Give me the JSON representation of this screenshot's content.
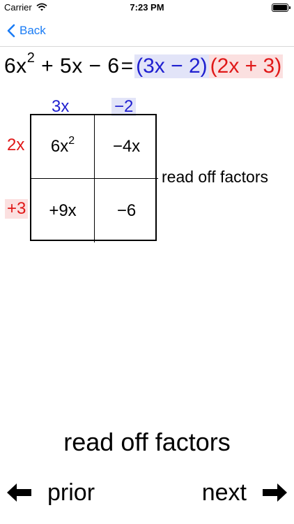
{
  "status_bar": {
    "carrier": "Carrier",
    "time": "7:23 PM"
  },
  "nav": {
    "back_label": "Back"
  },
  "equation": {
    "lhs_coef": "6x",
    "lhs_exp": "2",
    "lhs_rest": "+ 5x − 6",
    "equals": "=",
    "factor1": "(3x − 2)",
    "factor2": "(2x + 3)"
  },
  "grid": {
    "col_headers": [
      "3x",
      "−2"
    ],
    "row_headers": [
      "2x",
      "+3"
    ],
    "cells": [
      {
        "base": "6x",
        "exp": "2"
      },
      {
        "base": "−4x",
        "exp": ""
      },
      {
        "base": "+9x",
        "exp": ""
      },
      {
        "base": "−6",
        "exp": ""
      }
    ]
  },
  "side_note": "read off factors",
  "instruction": "read off factors",
  "controls": {
    "prior_label": "prior",
    "next_label": "next"
  },
  "colors": {
    "accent_blue": "#1a7cf5",
    "factor_blue": "#2020d0",
    "factor_red": "#e01818"
  }
}
